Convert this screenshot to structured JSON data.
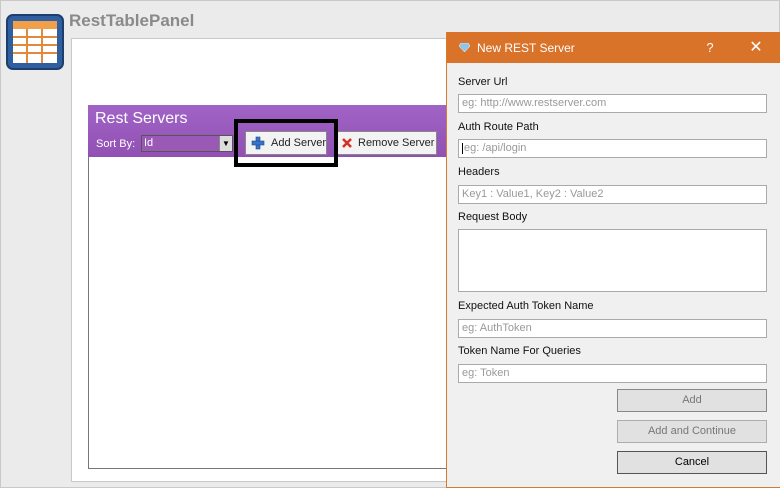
{
  "app": {
    "title": "RestTablePanel"
  },
  "rest_panel": {
    "title": "Rest Servers",
    "sort_by_label": "Sort By:",
    "sort_by_value": "Id",
    "add_server_label": "Add Server",
    "remove_server_label": "Remove Server"
  },
  "dialog": {
    "title": "New REST Server",
    "help": "?",
    "close": "✕",
    "fields": {
      "server_url": {
        "label": "Server Url",
        "placeholder": "eg: http://www.restserver.com"
      },
      "auth_route": {
        "label": "Auth Route Path",
        "placeholder": "eg: /api/login"
      },
      "headers": {
        "label": "Headers",
        "placeholder": "Key1 : Value1,  Key2 : Value2"
      },
      "request_body": {
        "label": "Request Body"
      },
      "auth_token_name": {
        "label": "Expected Auth Token Name",
        "placeholder": "eg: AuthToken"
      },
      "token_name_queries": {
        "label": "Token Name For Queries",
        "placeholder": "eg: Token"
      }
    },
    "buttons": {
      "add": "Add",
      "add_continue": "Add and Continue",
      "cancel": "Cancel"
    }
  },
  "colors": {
    "purple_header": "#9b59b6",
    "dialog_titlebar": "#d9732a"
  }
}
